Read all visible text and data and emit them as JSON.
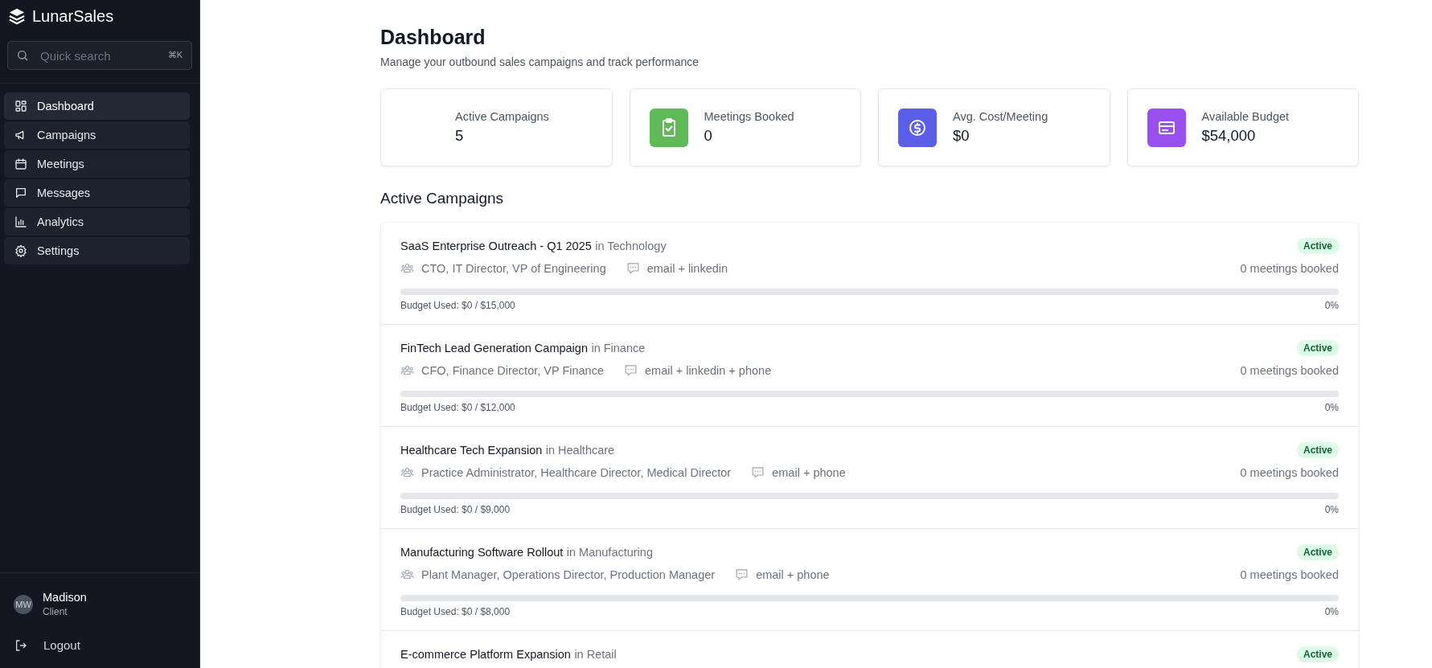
{
  "sidebar": {
    "brand": "LunarSales",
    "search": {
      "placeholder": "Quick search",
      "shortcut": "⌘K"
    },
    "items": [
      {
        "label": "Dashboard",
        "kind": "grid",
        "selected": true
      },
      {
        "label": "Campaigns",
        "kind": "megaphone",
        "selected": false
      },
      {
        "label": "Meetings",
        "kind": "calendar",
        "selected": false
      },
      {
        "label": "Messages",
        "kind": "chat",
        "selected": false
      },
      {
        "label": "Analytics",
        "kind": "chart",
        "selected": false
      },
      {
        "label": "Settings",
        "kind": "gear",
        "selected": false
      }
    ],
    "user": {
      "initials": "MW",
      "name": "Madison",
      "role": "Client"
    },
    "logout": "Logout"
  },
  "page": {
    "title": "Dashboard",
    "subtitle": "Manage your outbound sales campaigns and track performance"
  },
  "stats": [
    {
      "label": "Active Campaigns",
      "value": "5",
      "kind": "none"
    },
    {
      "label": "Meetings Booked",
      "value": "0",
      "kind": "clipboard",
      "color": "#5fb957"
    },
    {
      "label": "Avg. Cost/Meeting",
      "value": "$0",
      "kind": "dollar",
      "color": "#5a5ee8"
    },
    {
      "label": "Available Budget",
      "value": "$54,000",
      "kind": "card",
      "color": "#9a4ff0"
    }
  ],
  "campaigns_title": "Active Campaigns",
  "campaigns": [
    {
      "name": "SaaS Enterprise Outreach - Q1 2025",
      "category": "in Technology",
      "status": "Active",
      "roles": "CTO, IT Director, VP of Engineering",
      "channels": "email + linkedin",
      "meetings": "0 meetings booked",
      "budget": "Budget Used: $0 / $15,000",
      "percent": "0%"
    },
    {
      "name": "FinTech Lead Generation Campaign",
      "category": "in Finance",
      "status": "Active",
      "roles": "CFO, Finance Director, VP Finance",
      "channels": "email + linkedin + phone",
      "meetings": "0 meetings booked",
      "budget": "Budget Used: $0 / $12,000",
      "percent": "0%"
    },
    {
      "name": "Healthcare Tech Expansion",
      "category": "in Healthcare",
      "status": "Active",
      "roles": "Practice Administrator, Healthcare Director, Medical Director",
      "channels": "email + phone",
      "meetings": "0 meetings booked",
      "budget": "Budget Used: $0 / $9,000",
      "percent": "0%"
    },
    {
      "name": "Manufacturing Software Rollout",
      "category": "in Manufacturing",
      "status": "Active",
      "roles": "Plant Manager, Operations Director, Production Manager",
      "channels": "email + phone",
      "meetings": "0 meetings booked",
      "budget": "Budget Used: $0 / $8,000",
      "percent": "0%"
    },
    {
      "name": "E-commerce Platform Expansion",
      "category": "in Retail",
      "status": "Active"
    }
  ]
}
